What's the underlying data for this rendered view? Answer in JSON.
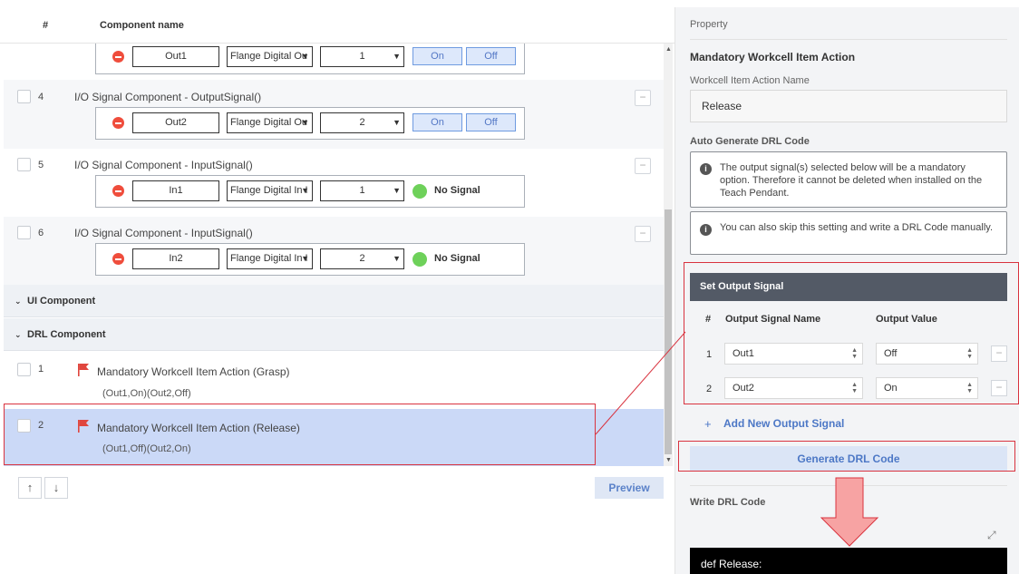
{
  "table": {
    "col_num": "#",
    "col_name": "Component name"
  },
  "rows": [
    {
      "io": {
        "name": "Out1",
        "type": "Flange Digital Ou",
        "index": "1",
        "on": "On",
        "off": "Off"
      }
    },
    {
      "num": "4",
      "title": "I/O Signal Component - OutputSignal()",
      "io": {
        "name": "Out2",
        "type": "Flange Digital Ou",
        "index": "2",
        "on": "On",
        "off": "Off"
      }
    },
    {
      "num": "5",
      "title": "I/O Signal Component - InputSignal()",
      "io": {
        "name": "In1",
        "type": "Flange Digital In I",
        "index": "1",
        "status": "No Signal"
      }
    },
    {
      "num": "6",
      "title": "I/O Signal Component - InputSignal()",
      "io": {
        "name": "In2",
        "type": "Flange Digital In I",
        "index": "2",
        "status": "No Signal"
      }
    }
  ],
  "sections": {
    "ui": "UI Component",
    "drl": "DRL Component"
  },
  "drl_items": [
    {
      "num": "1",
      "title": "Mandatory Workcell Item Action (Grasp)",
      "sub": "(Out1,On)(Out2,Off)"
    },
    {
      "num": "2",
      "title": "Mandatory Workcell Item Action (Release)",
      "sub": "(Out1,Off)(Out2,On)"
    }
  ],
  "footer": {
    "up": "↑",
    "down": "↓",
    "preview": "Preview"
  },
  "property": {
    "header": "Property",
    "title": "Mandatory Workcell Item Action",
    "name_label": "Workcell Item Action Name",
    "name_value": "Release",
    "auto_label": "Auto Generate DRL Code",
    "info1": "The output signal(s) selected below will be a mandatory option. Therefore it cannot be deleted when installed on the Teach Pendant.",
    "info2": "You can also skip this setting and write a DRL Code manually.",
    "set_output": {
      "header": "Set Output Signal",
      "col_num": "#",
      "col_name": "Output Signal Name",
      "col_value": "Output Value",
      "rows": [
        {
          "num": "1",
          "name": "Out1",
          "value": "Off"
        },
        {
          "num": "2",
          "name": "Out2",
          "value": "On"
        }
      ]
    },
    "add_new": "Add New Output Signal",
    "generate": "Generate DRL Code",
    "write_label": "Write DRL Code",
    "code": "def Release:"
  },
  "colors": {
    "accent": "#4d78c6",
    "highlight": "#cbd9f7",
    "annotation": "#d9333f",
    "arrow_fill": "#f7a3a3"
  }
}
